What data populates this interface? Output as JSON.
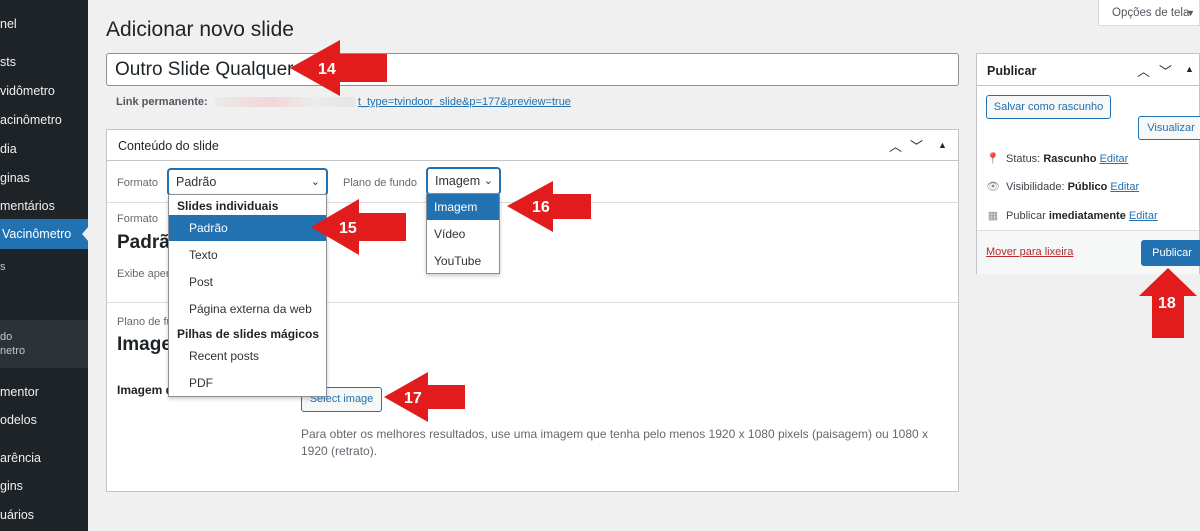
{
  "sidebar": {
    "items": [
      {
        "label": "nel"
      },
      {
        "label": "sts"
      },
      {
        "label": "vidômetro"
      },
      {
        "label": "acinômetro"
      },
      {
        "label": "dia"
      },
      {
        "label": "ginas"
      },
      {
        "label": "mentários"
      },
      {
        "label": "Vacinômetro"
      },
      {
        "label": "s"
      },
      {
        "label": "do"
      },
      {
        "label": "netro"
      },
      {
        "label": "mentor"
      },
      {
        "label": "odelos"
      },
      {
        "label": "arência"
      },
      {
        "label": "gins"
      },
      {
        "label": "uários"
      }
    ]
  },
  "screen_options": {
    "label": "Opções de tela"
  },
  "page_title": "Adicionar novo slide",
  "title_input": {
    "value": "Outro Slide Qualquer"
  },
  "permalink": {
    "label": "Link permanente:",
    "url": "t_type=tvindoor_slide&p=177&preview=true"
  },
  "content_box": {
    "title": "Conteúdo do slide",
    "format_label": "Formato",
    "format_value": "Padrão",
    "background_label": "Plano de fundo",
    "background_value": "Imagem",
    "behind": {
      "format_small": "Formato",
      "format_big": "Padrão",
      "format_desc": "Exibe apen",
      "bg_small": "Plano de fu",
      "bg_big": "Image"
    },
    "image_label": "Imagem d",
    "select_image_label": "Select image",
    "image_hint": "Para obter os melhores resultados, use uma imagem que tenha pelo menos 1920 x 1080 pixels (paisagem) ou 1080 x 1920 (retrato)."
  },
  "format_dropdown": {
    "groups": [
      {
        "label": "Slides individuais",
        "items": [
          "Padrão",
          "Texto",
          "Post",
          "Página externa da web"
        ]
      },
      {
        "label": "Pilhas de slides mágicos",
        "items": [
          "Recent posts",
          "PDF"
        ]
      }
    ],
    "selected": "Padrão"
  },
  "background_dropdown": {
    "items": [
      "Imagem",
      "Vídeo",
      "YouTube"
    ],
    "selected": "Imagem"
  },
  "publish": {
    "title": "Publicar",
    "save_draft": "Salvar como rascunho",
    "preview": "Visualizar",
    "status_label": "Status:",
    "status_value": "Rascunho",
    "visibility_label": "Visibilidade:",
    "visibility_value": "Público",
    "publish_label": "Publicar",
    "publish_value": "imediatamente",
    "edit": "Editar",
    "trash": "Mover para lixeira",
    "publish_button": "Publicar"
  },
  "annotations": [
    "14",
    "15",
    "16",
    "17",
    "18"
  ],
  "colors": {
    "accent": "#2271b1",
    "annotation": "#e21c1c",
    "sidebar": "#1d2327"
  }
}
